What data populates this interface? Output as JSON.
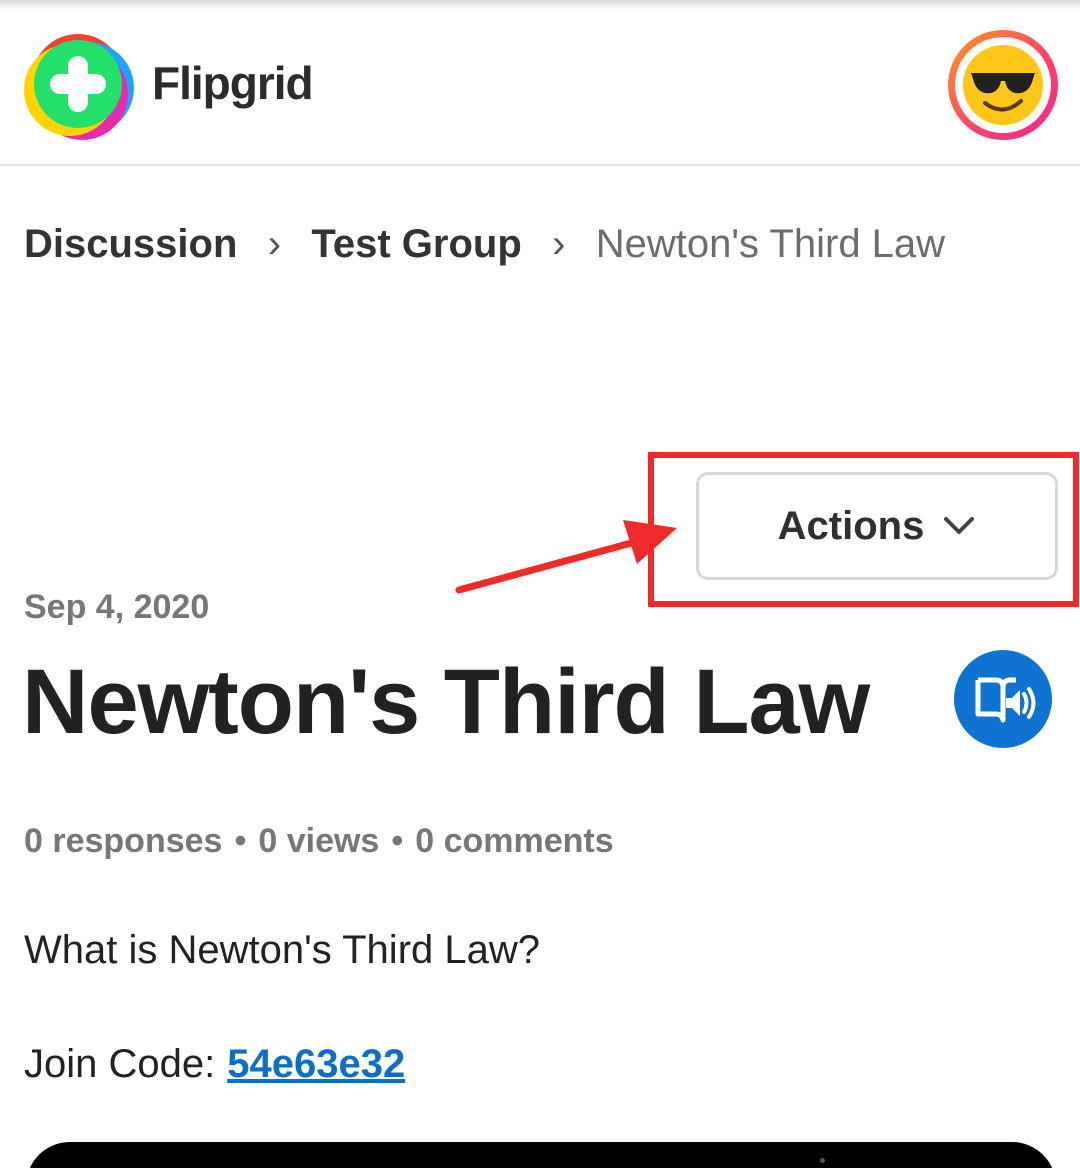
{
  "app": {
    "name": "Flipgrid",
    "brand_colors": {
      "logo_green": "#22e06a",
      "logo_red": "#f4402f",
      "logo_blue": "#1fa3ff",
      "logo_magenta": "#ea28b4",
      "logo_yellow": "#ffd400",
      "accent_blue": "#0f74d1",
      "link_blue": "#0c6fc7",
      "annotation_red": "#ee2a2a"
    }
  },
  "header": {
    "logo_icon": "flipgrid-plus-icon",
    "avatar_icon": "sunglasses-emoji-icon"
  },
  "breadcrumb": {
    "items": [
      "Discussion",
      "Test Group"
    ],
    "current": "Newton's Third Law",
    "separator": "›"
  },
  "actions": {
    "label": "Actions",
    "icon": "chevron-down-icon"
  },
  "topic": {
    "date": "Sep 4, 2020",
    "title": "Newton's Third Law",
    "reader_icon": "immersive-reader-icon",
    "stats": {
      "responses": "0 responses",
      "views": "0 views",
      "comments": "0 comments",
      "separator": "•"
    },
    "prompt": "What is Newton's Third Law?",
    "join_label": "Join Code:",
    "join_code": "54e63e32"
  }
}
